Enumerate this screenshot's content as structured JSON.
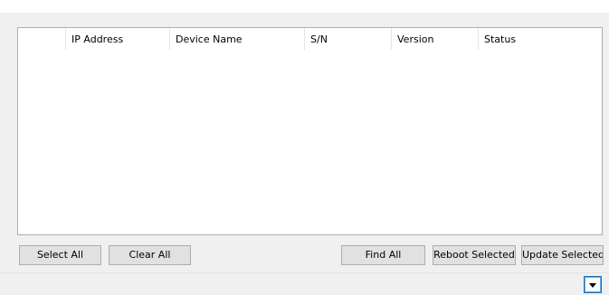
{
  "device_table": {
    "columns": [
      {
        "label": ""
      },
      {
        "label": "IP Address"
      },
      {
        "label": "Device Name"
      },
      {
        "label": "S/N"
      },
      {
        "label": "Version"
      },
      {
        "label": "Status"
      }
    ],
    "rows": []
  },
  "buttons": {
    "select_all": "Select All",
    "clear_all": "Clear All",
    "find_all": "Find All",
    "reboot_selected": "Reboot Selected",
    "update_selected": "Update Selected"
  },
  "expander": {
    "icon": "triangle-down-icon"
  }
}
